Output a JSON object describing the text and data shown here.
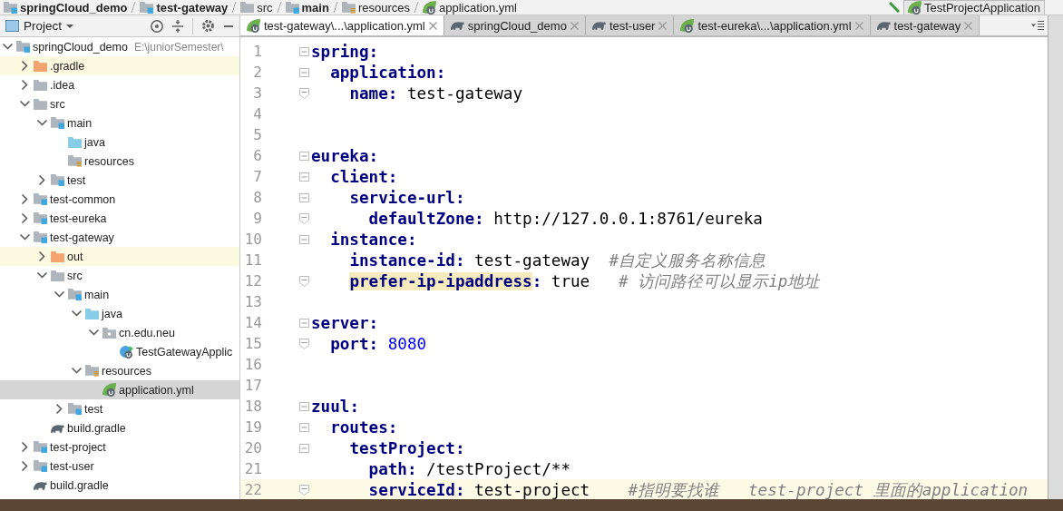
{
  "breadcrumbs": [
    {
      "label": "springCloud_demo",
      "kind": "module"
    },
    {
      "label": "test-gateway",
      "kind": "module"
    },
    {
      "label": "src",
      "kind": "folder"
    },
    {
      "label": "main",
      "kind": "module"
    },
    {
      "label": "resources",
      "kind": "resources"
    },
    {
      "label": "application.yml",
      "kind": "spring"
    }
  ],
  "run_config": {
    "label": "TestProjectApplication"
  },
  "project_panel": {
    "title": "Project",
    "tree": [
      {
        "label": "springCloud_demo",
        "path": "E:\\juniorSemester\\",
        "kind": "module",
        "expanded": true,
        "excluded": false,
        "selected": false,
        "children": [
          {
            "label": ".gradle",
            "kind": "excluded",
            "expanded": false,
            "excluded": true,
            "selected": false
          },
          {
            "label": ".idea",
            "kind": "folder",
            "expanded": false,
            "excluded": false,
            "selected": false
          },
          {
            "label": "src",
            "kind": "folder",
            "expanded": true,
            "excluded": false,
            "selected": false,
            "children": [
              {
                "label": "main",
                "kind": "module",
                "expanded": true,
                "excluded": false,
                "selected": false,
                "children": [
                  {
                    "label": "java",
                    "kind": "source",
                    "excluded": false,
                    "selected": false
                  },
                  {
                    "label": "resources",
                    "kind": "resources",
                    "excluded": false,
                    "selected": false
                  }
                ]
              },
              {
                "label": "test",
                "kind": "module",
                "expanded": false,
                "excluded": false,
                "selected": false
              }
            ]
          },
          {
            "label": "test-common",
            "kind": "module",
            "expanded": false,
            "excluded": false,
            "selected": false
          },
          {
            "label": "test-eureka",
            "kind": "module",
            "expanded": false,
            "excluded": false,
            "selected": false
          },
          {
            "label": "test-gateway",
            "kind": "module",
            "expanded": true,
            "excluded": false,
            "selected": false,
            "children": [
              {
                "label": "out",
                "kind": "excluded",
                "expanded": false,
                "excluded": true,
                "selected": false
              },
              {
                "label": "src",
                "kind": "folder",
                "expanded": true,
                "excluded": false,
                "selected": false,
                "children": [
                  {
                    "label": "main",
                    "kind": "module",
                    "expanded": true,
                    "excluded": false,
                    "selected": false,
                    "children": [
                      {
                        "label": "java",
                        "kind": "source",
                        "expanded": true,
                        "excluded": false,
                        "selected": false,
                        "children": [
                          {
                            "label": "cn.edu.neu",
                            "kind": "package",
                            "expanded": true,
                            "excluded": false,
                            "selected": false,
                            "children": [
                              {
                                "label": "TestGatewayApplic",
                                "kind": "spring-class",
                                "excluded": false,
                                "selected": false
                              }
                            ]
                          }
                        ]
                      },
                      {
                        "label": "resources",
                        "kind": "resources",
                        "expanded": true,
                        "excluded": false,
                        "selected": false,
                        "children": [
                          {
                            "label": "application.yml",
                            "kind": "spring",
                            "excluded": false,
                            "selected": true
                          }
                        ]
                      }
                    ]
                  },
                  {
                    "label": "test",
                    "kind": "module",
                    "expanded": false,
                    "excluded": false,
                    "selected": false
                  }
                ]
              },
              {
                "label": "build.gradle",
                "kind": "gradle",
                "excluded": false,
                "selected": false
              }
            ]
          },
          {
            "label": "test-project",
            "kind": "module",
            "expanded": false,
            "excluded": false,
            "selected": false
          },
          {
            "label": "test-user",
            "kind": "module",
            "expanded": false,
            "excluded": false,
            "selected": false
          },
          {
            "label": "build.gradle",
            "kind": "gradle",
            "excluded": false,
            "selected": false
          }
        ]
      }
    ]
  },
  "tabs": [
    {
      "label": "test-gateway\\...\\application.yml",
      "kind": "spring",
      "selected": true
    },
    {
      "label": "springCloud_demo",
      "kind": "gradle",
      "selected": false
    },
    {
      "label": "test-user",
      "kind": "gradle",
      "selected": false
    },
    {
      "label": "test-eureka\\...\\application.yml",
      "kind": "spring",
      "selected": false
    },
    {
      "label": "test-gateway",
      "kind": "gradle",
      "selected": false
    }
  ],
  "editor": {
    "lines": [
      {
        "number": "1",
        "fold_start": true,
        "fold_end": false,
        "current": false,
        "key": "spring",
        "rest": ":"
      },
      {
        "number": "2",
        "fold_start": true,
        "fold_end": false,
        "current": false,
        "key": "  application",
        "rest": ":"
      },
      {
        "number": "3",
        "fold_start": false,
        "fold_end": true,
        "current": false,
        "key": "    name",
        "rest": ": test-gateway"
      },
      {
        "number": "4",
        "fold_start": false,
        "fold_end": false,
        "current": false
      },
      {
        "number": "5",
        "fold_start": false,
        "fold_end": false,
        "current": false
      },
      {
        "number": "6",
        "fold_start": true,
        "fold_end": false,
        "current": false,
        "key": "eureka",
        "rest": ":"
      },
      {
        "number": "7",
        "fold_start": true,
        "fold_end": false,
        "current": false,
        "key": "  client",
        "rest": ":"
      },
      {
        "number": "8",
        "fold_start": true,
        "fold_end": false,
        "current": false,
        "key": "    service-url",
        "rest": ":"
      },
      {
        "number": "9",
        "fold_start": false,
        "fold_end": true,
        "current": false,
        "key": "      defaultZone",
        "rest": ": http://127.0.0.1:8761/eureka"
      },
      {
        "number": "10",
        "fold_start": true,
        "fold_end": false,
        "current": false,
        "key": "  instance",
        "rest": ":"
      },
      {
        "number": "11",
        "fold_start": false,
        "fold_end": false,
        "current": false,
        "key": "    instance-id",
        "rest": ": test-gateway  ",
        "comment": "#自定义服务名称信息"
      },
      {
        "number": "12",
        "fold_start": false,
        "fold_end": true,
        "current": false,
        "highlighted": true,
        "key": "    prefer-ip-ipaddress",
        "rest": ": true   ",
        "comment": "# 访问路径可以显示ip地址"
      },
      {
        "number": "13",
        "fold_start": false,
        "fold_end": false,
        "current": false
      },
      {
        "number": "14",
        "fold_start": true,
        "fold_end": false,
        "current": false,
        "key": "server",
        "rest": ":"
      },
      {
        "number": "15",
        "fold_start": false,
        "fold_end": true,
        "current": false,
        "key": "  port",
        "rest": ": ",
        "number_value": "8080"
      },
      {
        "number": "16",
        "fold_start": false,
        "fold_end": false,
        "current": false
      },
      {
        "number": "17",
        "fold_start": false,
        "fold_end": false,
        "current": false
      },
      {
        "number": "18",
        "fold_start": true,
        "fold_end": false,
        "current": false,
        "key": "zuul",
        "rest": ":"
      },
      {
        "number": "19",
        "fold_start": true,
        "fold_end": false,
        "current": false,
        "key": "  routes",
        "rest": ":"
      },
      {
        "number": "20",
        "fold_start": true,
        "fold_end": false,
        "current": false,
        "key": "    testProject",
        "rest": ":"
      },
      {
        "number": "21",
        "fold_start": false,
        "fold_end": false,
        "current": false,
        "key": "      path",
        "rest": ": /testProject/**"
      },
      {
        "number": "22",
        "fold_start": false,
        "fold_end": true,
        "current": true,
        "key": "      serviceId",
        "rest": ": test-project    ",
        "comment": "#指明要找谁   test-project 里面的application"
      }
    ]
  }
}
